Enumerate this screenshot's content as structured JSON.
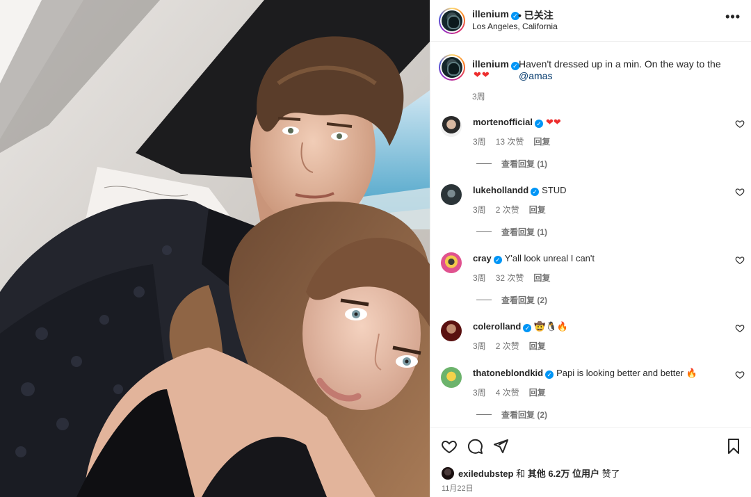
{
  "post": {
    "username": "illenium",
    "follow_status": "• 已关注",
    "location": "Los Angeles, California",
    "more_label": "•••"
  },
  "caption": {
    "username": "illenium",
    "text": "Haven't dressed up in a min. On the way to the ",
    "mention": "@amas",
    "emoji": "❤❤",
    "time": "3周"
  },
  "comments": [
    {
      "user": "mortenofficial",
      "text": "❤❤",
      "time": "3周",
      "likes": "13 次赞",
      "reply": "回复",
      "replies": "查看回复 (1)"
    },
    {
      "user": "lukehollandd",
      "text": "STUD",
      "time": "3周",
      "likes": "2 次赞",
      "reply": "回复",
      "replies": "查看回复 (1)"
    },
    {
      "user": "cray",
      "text": "Y'all look unreal I can't",
      "time": "3周",
      "likes": "32 次赞",
      "reply": "回复",
      "replies": "查看回复 (2)"
    },
    {
      "user": "colerolland",
      "text": "🤠🐧🔥",
      "time": "3周",
      "likes": "2 次赞",
      "reply": "回复",
      "replies": ""
    },
    {
      "user": "thatoneblondkid",
      "text": "Papi is looking better and better 🔥",
      "time": "3周",
      "likes": "4 次赞",
      "reply": "回复",
      "replies": "查看回复 (2)"
    }
  ],
  "footer": {
    "liked_by_user": "exiledubstep",
    "liked_mid": " 和 ",
    "liked_others": "其他 6.2万 位用户",
    "liked_end": " 赞了",
    "date": "11月22日"
  },
  "colors": {
    "accent_blue": "#0095f6",
    "mention": "#00376b",
    "muted": "#737373",
    "heart_red": "#ed2e2e"
  },
  "icons": {
    "like": "heart-outline-icon",
    "comment": "comment-bubble-icon",
    "share": "paper-plane-icon",
    "save": "bookmark-icon",
    "more": "ellipsis-icon",
    "verified": "verified-badge-icon"
  }
}
